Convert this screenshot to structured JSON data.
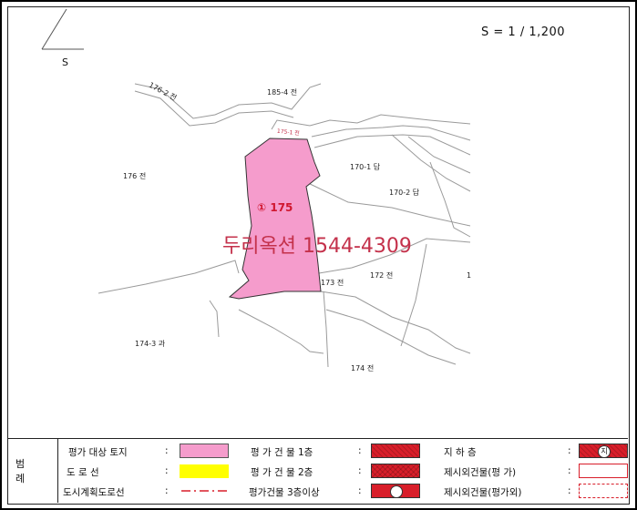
{
  "scale": "S = 1 / 1,200",
  "north_label": "S",
  "watermark": "두리옥션 1544-4309",
  "subject_parcel": {
    "label": "① 175",
    "fill": "#f59ccc"
  },
  "parcels": [
    {
      "id": "p185-4",
      "label": "185-4 전"
    },
    {
      "id": "p176-2",
      "label": "176-2 전"
    },
    {
      "id": "p175-1",
      "label": "175-1 전"
    },
    {
      "id": "p176",
      "label": "176 전"
    },
    {
      "id": "p170-1",
      "label": "170-1 답"
    },
    {
      "id": "p170-2",
      "label": "170-2 답"
    },
    {
      "id": "p173",
      "label": "173 전"
    },
    {
      "id": "p172",
      "label": "172 전"
    },
    {
      "id": "p1",
      "label": "1"
    },
    {
      "id": "p174-3",
      "label": "174-3 과"
    },
    {
      "id": "p174",
      "label": "174 전"
    }
  ],
  "legend": {
    "title": "범 례",
    "items": {
      "target_land": "평가 대상 토지",
      "road": "도  로  선",
      "city_road": "도시계획도로선",
      "bldg_1f": "평 가 건 물  1층",
      "bldg_2f": "평 가 건 물  2층",
      "bldg_3f": "평가건물 3층이상",
      "basement": "지        하        층",
      "basement_mark": "지",
      "other_bldg": "제시외건물(평 가)",
      "other_bldg_ex": "제시외건물(평가외)"
    },
    "colon": ":",
    "colors": {
      "pink": "#f59ccc",
      "yellow": "#ffff00",
      "red": "#d81e2a"
    }
  }
}
